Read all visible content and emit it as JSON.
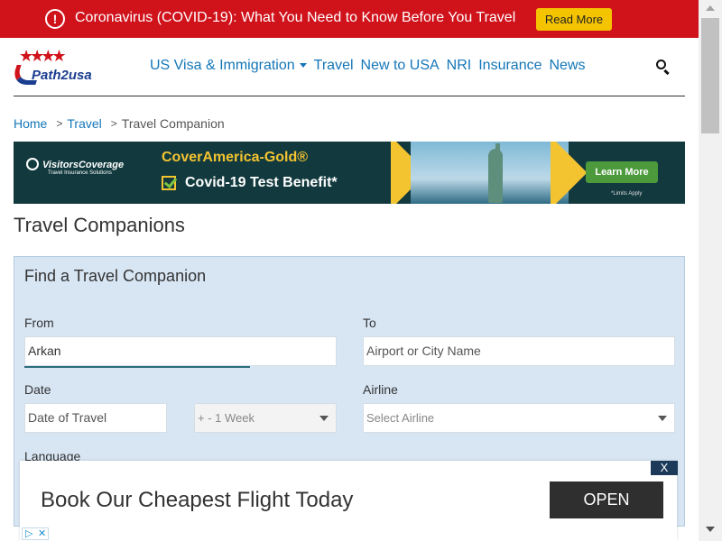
{
  "covid_banner": {
    "message": "Coronavirus (COVID-19): What You Need to Know Before You Travel",
    "button": "Read More",
    "icon": "alert-circle-icon"
  },
  "header": {
    "logo_text": "Path2usa",
    "nav": [
      "US Visa & Immigration",
      "Travel",
      "New to USA",
      "NRI",
      "Insurance",
      "News"
    ],
    "search_icon": "search-icon"
  },
  "breadcrumb": {
    "items": [
      "Home",
      "Travel",
      "Travel Companion"
    ],
    "separator": ">"
  },
  "ad_banner": {
    "brand": "VisitorsCoverage",
    "brand_sub": "Travel Insurance Solutions",
    "product": "CoverAmerica-Gold®",
    "benefit": "Covid-19 Test Benefit*",
    "button": "Learn More",
    "note": "*Limits Apply"
  },
  "page": {
    "title": "Travel Companions"
  },
  "form": {
    "title": "Find a Travel Companion",
    "from_label": "From",
    "from_value": "Arkan",
    "to_label": "To",
    "to_placeholder": "Airport or City Name",
    "date_label": "Date",
    "date_placeholder": "Date of Travel",
    "range_value": "+ - 1 Week",
    "airline_label": "Airline",
    "airline_placeholder": "Select Airline",
    "language_label": "Language"
  },
  "bottom_ad": {
    "headline": "Book Our Cheapest Flight Today",
    "button": "OPEN",
    "close": "X"
  },
  "colors": {
    "banner_red": "#d0121b",
    "link_blue": "#1476b8",
    "form_bg": "#d8e6f4",
    "ad_dark": "#123a3e",
    "accent_yellow": "#f4c430"
  }
}
